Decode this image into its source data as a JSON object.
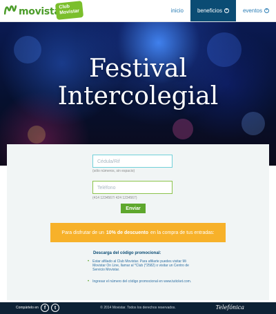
{
  "header": {
    "brand": "movistar",
    "club_badge_line1": "Club",
    "club_badge_line2": "Movistar",
    "nav": [
      {
        "label": "inicio",
        "active": false
      },
      {
        "label": "beneficios",
        "active": true
      },
      {
        "label": "eventos",
        "active": false
      }
    ],
    "nav_plus_glyph": "+"
  },
  "hero": {
    "title_line1": "Festival",
    "title_line2": "Intercolegial"
  },
  "form": {
    "id_placeholder": "Cédula/Rif",
    "id_hint": "(sólo números, sin espacio)",
    "phone_placeholder": "Teléfono",
    "phone_hint": "(414 1234567/ 424 1234567)",
    "submit_label": "Enviar"
  },
  "promo": {
    "text_before": "Para disfrutar de un",
    "text_highlight": "10% de descuento",
    "text_after": "en la compra de tus entradas:"
  },
  "steps": {
    "title": "Descarga del código promocional:",
    "items": [
      "Estar afiliado al Club Movistar. Para afiliarte puedes visitar Mi Movistar On Line, llamar al *Club (*2582) o visitar un Centro de Servicio Movistar.",
      "Ingresar el número del código promocional en www.tuticket.com."
    ],
    "bullet": "•"
  },
  "footer": {
    "share_label": "Compártelo en",
    "facebook_glyph": "f",
    "twitter_glyph": "t",
    "copyright": "© 2014 Movistar. Todos los derechos reservados.",
    "partner": "Telefónica"
  },
  "colors": {
    "brand_green": "#5ea72d",
    "nav_active": "#0b4c74",
    "promo_orange": "#f7b12a",
    "footer_bg": "#0e2235"
  },
  "icons": [
    "movistar-m-icon",
    "plus-circle-icon",
    "facebook-icon",
    "twitter-icon"
  ]
}
